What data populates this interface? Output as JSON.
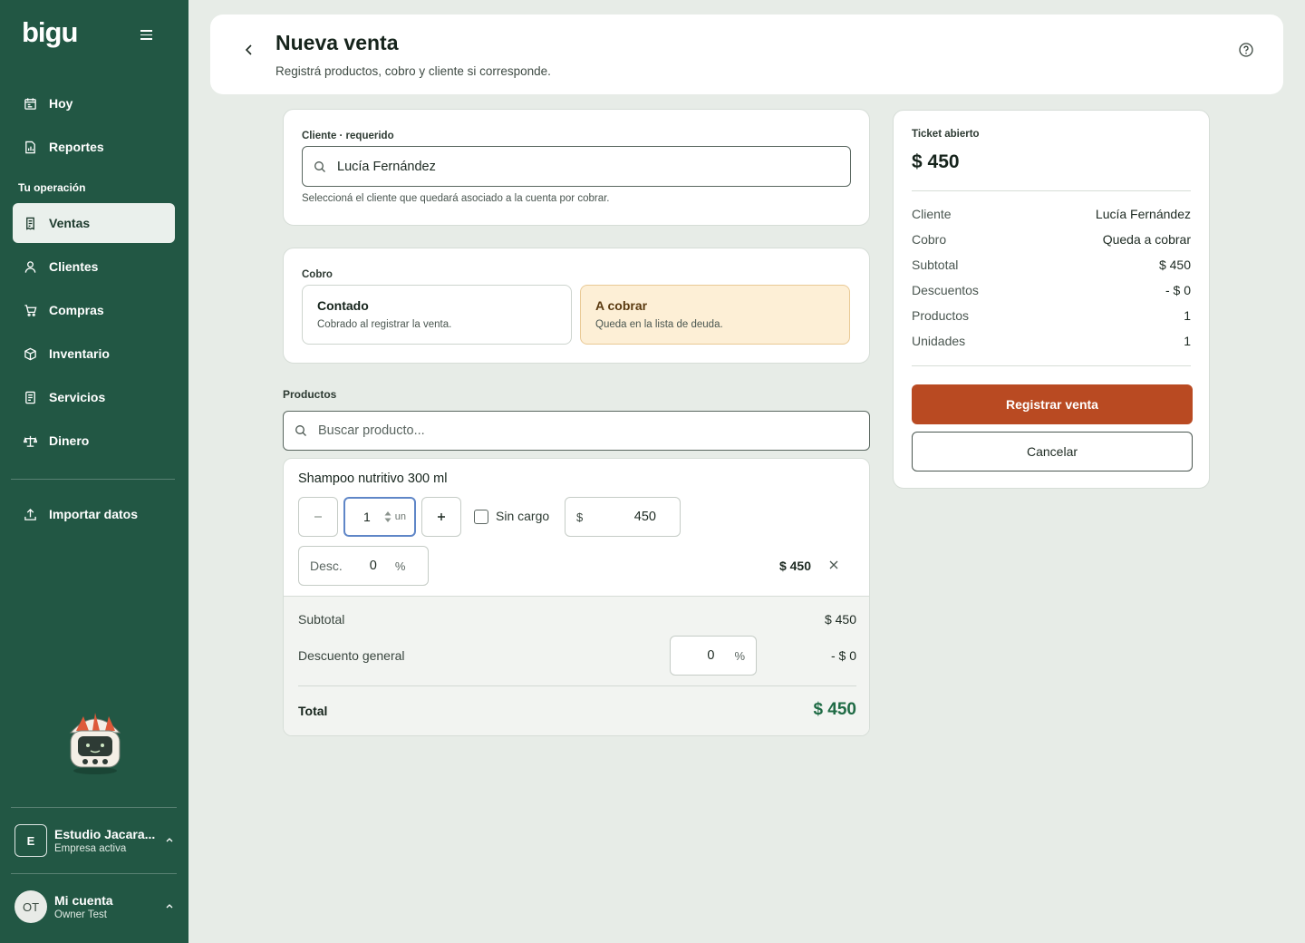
{
  "app": {
    "logo": "bigu"
  },
  "sidebar": {
    "items_top": [
      {
        "label": "Hoy",
        "icon": "calendar-icon"
      },
      {
        "label": "Reportes",
        "icon": "report-icon"
      }
    ],
    "section_label": "Tu operación",
    "items": [
      {
        "label": "Ventas",
        "icon": "receipt-icon",
        "active": true
      },
      {
        "label": "Clientes",
        "icon": "user-icon"
      },
      {
        "label": "Compras",
        "icon": "cart-icon"
      },
      {
        "label": "Inventario",
        "icon": "box-icon"
      },
      {
        "label": "Servicios",
        "icon": "document-icon"
      },
      {
        "label": "Dinero",
        "icon": "scale-icon"
      }
    ],
    "import_label": "Importar datos",
    "company": {
      "initial": "E",
      "name": "Estudio Jacara...",
      "status": "Empresa activa"
    },
    "account": {
      "initials": "OT",
      "title": "Mi cuenta",
      "user": "Owner Test"
    }
  },
  "header": {
    "title": "Nueva venta",
    "subtitle": "Registrá productos, cobro y cliente si corresponde."
  },
  "client": {
    "label": "Cliente · requerido",
    "value": "Lucía Fernández",
    "helper": "Seleccioná el cliente que quedará asociado a la cuenta por cobrar."
  },
  "payment": {
    "label": "Cobro",
    "options": [
      {
        "title": "Contado",
        "desc": "Cobrado al registrar la venta.",
        "selected": false
      },
      {
        "title": "A cobrar",
        "desc": "Queda en la lista de deuda.",
        "selected": true
      }
    ]
  },
  "products": {
    "label": "Productos",
    "search_placeholder": "Buscar producto...",
    "item": {
      "name": "Shampoo nutritivo 300 ml",
      "qty": "1",
      "unit": "un",
      "free_label": "Sin cargo",
      "currency": "$",
      "price": "450",
      "discount_label": "Desc.",
      "discount_value": "0",
      "percent": "%",
      "line_total": "$ 450"
    },
    "summary": {
      "subtotal_label": "Subtotal",
      "subtotal_value": "$ 450",
      "discount_label": "Descuento general",
      "discount_input": "0",
      "discount_percent": "%",
      "discount_value": "- $ 0",
      "total_label": "Total",
      "total_value": "$ 450"
    }
  },
  "ticket": {
    "label": "Ticket abierto",
    "amount": "$ 450",
    "rows": [
      {
        "k": "Cliente",
        "v": "Lucía Fernández"
      },
      {
        "k": "Cobro",
        "v": "Queda a cobrar"
      },
      {
        "k": "Subtotal",
        "v": "$ 450"
      },
      {
        "k": "Descuentos",
        "v": "- $ 0"
      },
      {
        "k": "Productos",
        "v": "1"
      },
      {
        "k": "Unidades",
        "v": "1"
      }
    ],
    "submit_label": "Registrar venta",
    "cancel_label": "Cancelar"
  },
  "colors": {
    "sidebar_bg": "#225744",
    "accent": "#b94a22",
    "total_green": "#1f6b45",
    "selected_option_bg": "#fdefd6"
  }
}
